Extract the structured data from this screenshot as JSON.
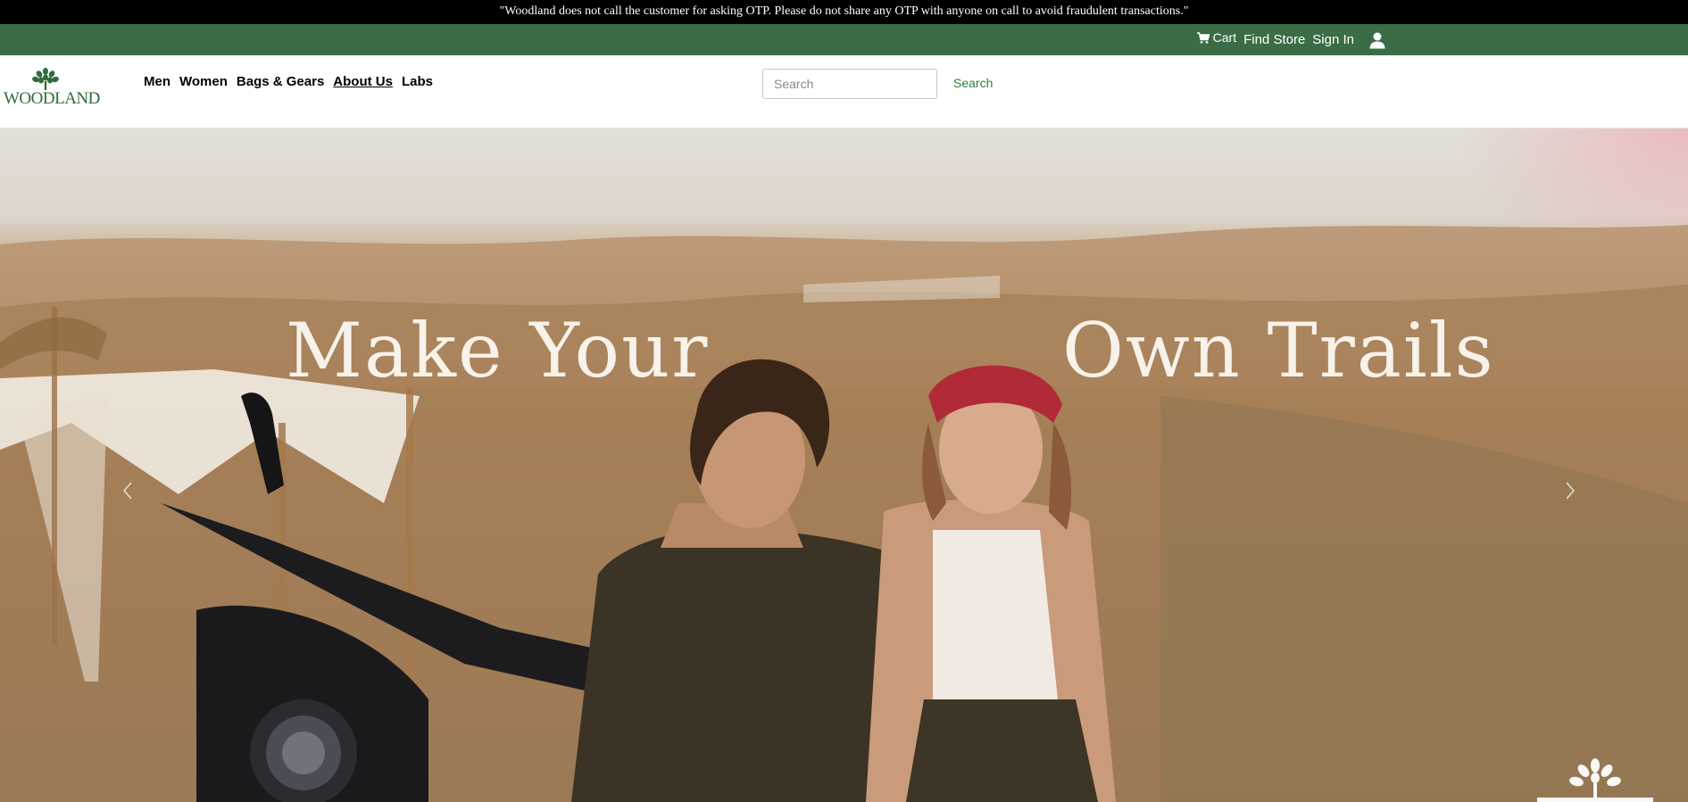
{
  "notice": {
    "text": "\"Woodland does not call the customer for asking OTP. Please do not share any OTP with anyone on call to avoid fraudulent transactions.\""
  },
  "utility": {
    "cart_label": "Cart",
    "find_store_label": "Find Store",
    "sign_in_label": "Sign In",
    "cart_icon": "cart-icon",
    "user_icon": "user-icon"
  },
  "header": {
    "logo_text": "WOODLAND",
    "nav": [
      {
        "label": "Men"
      },
      {
        "label": "Women"
      },
      {
        "label": "Bags & Gears"
      },
      {
        "label": "About Us"
      },
      {
        "label": "Labs"
      }
    ],
    "active_nav": "About Us",
    "search": {
      "placeholder": "Search",
      "value": "",
      "button_label": "Search"
    }
  },
  "hero": {
    "headline_part_1": "Make Your",
    "headline_part_2": "Own Trails",
    "prev_icon": "chevron-left-icon",
    "next_icon": "chevron-right-icon",
    "watermark_icon": "woodland-tree-logo"
  },
  "colors": {
    "notice_bg": "#000000",
    "utility_bg": "#3a6d45",
    "brand_green": "#2f6b3d",
    "search_link": "#2f7d3f"
  }
}
